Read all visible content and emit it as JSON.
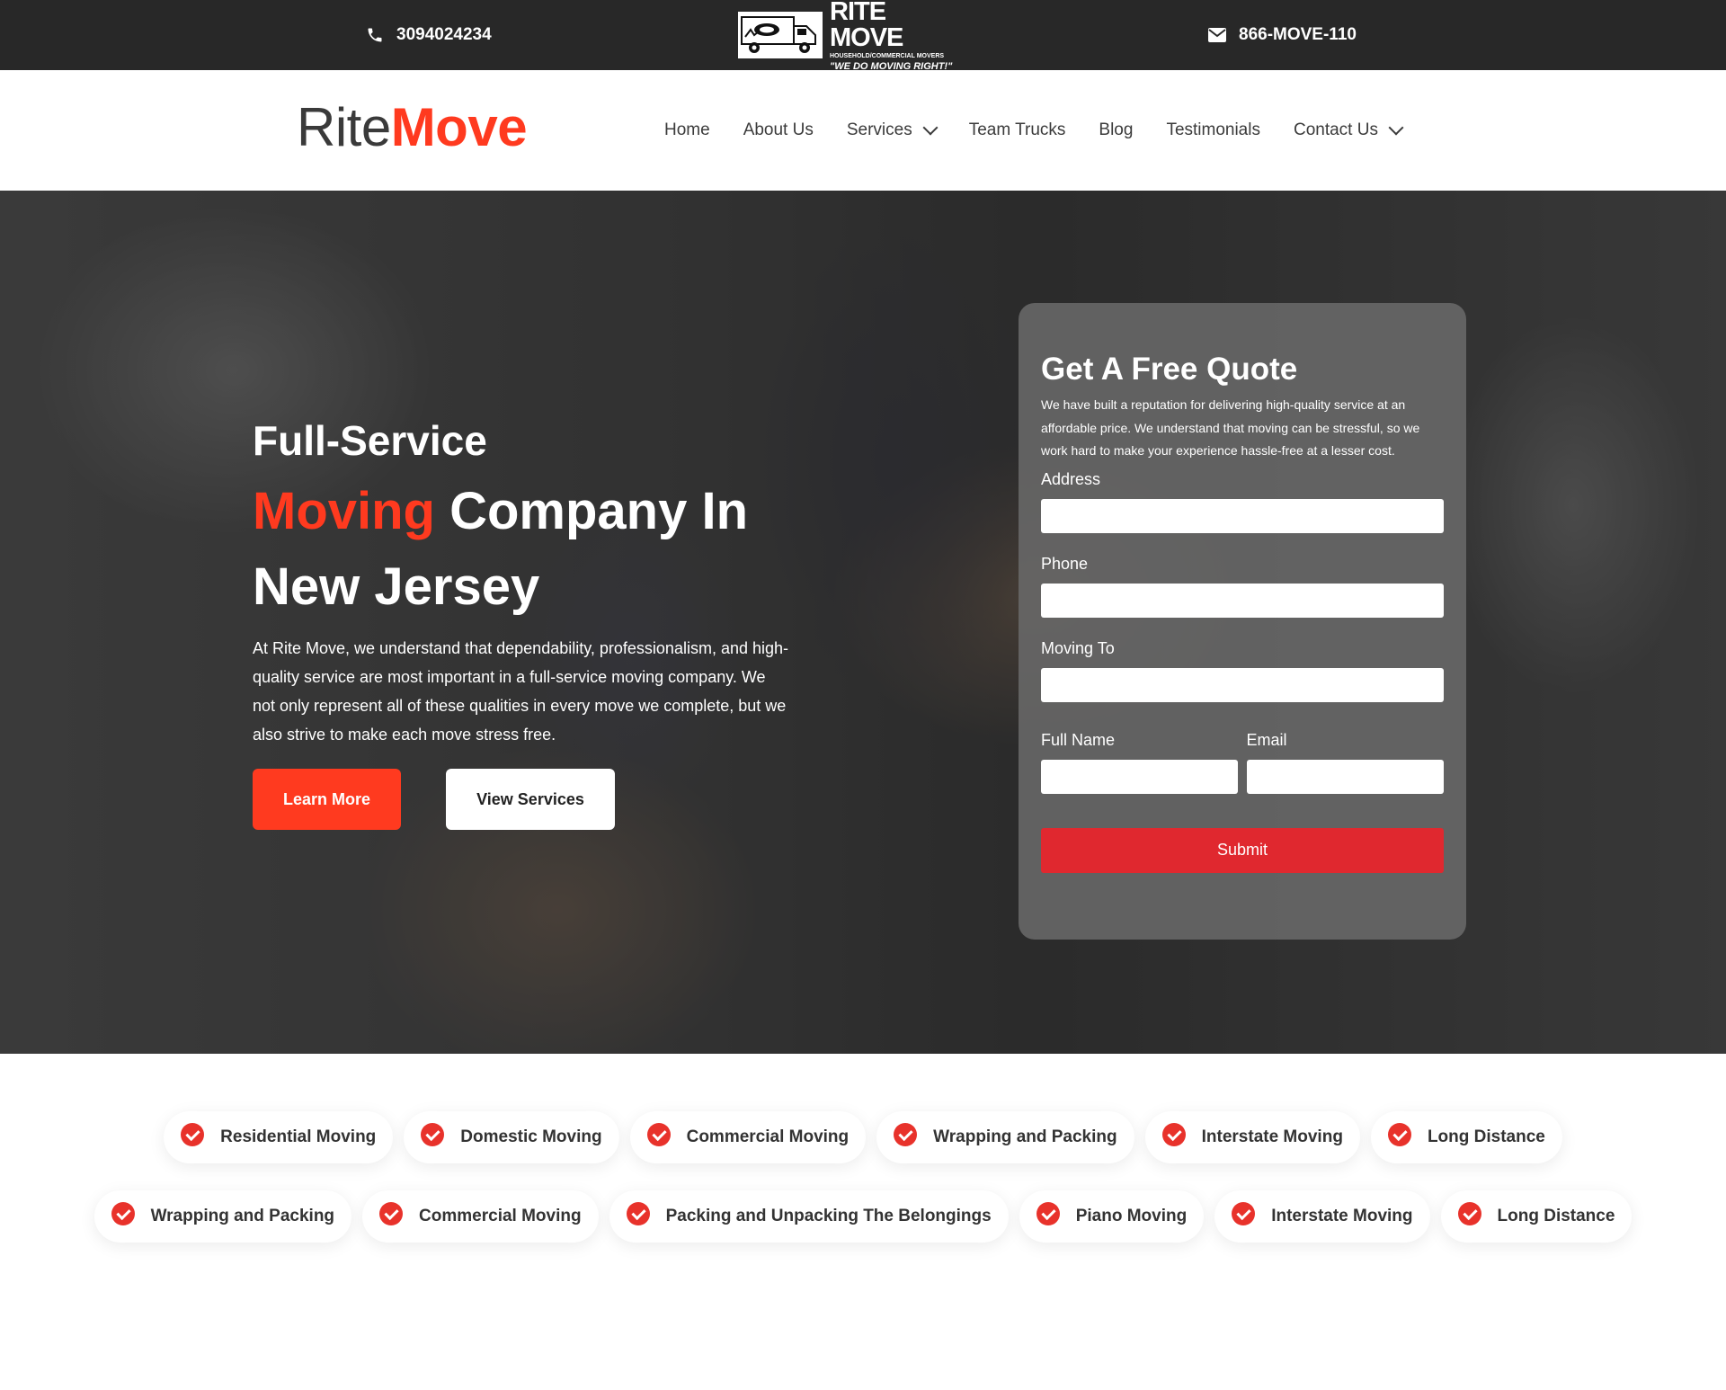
{
  "topbar": {
    "phone": "3094024234",
    "email_phone": "866-MOVE-110",
    "logo": {
      "name": "RITE MOVE",
      "tagline": "HOUSEHOLD/COMMERCIAL MOVERS",
      "slogan": "\"WE DO MOVING RIGHT!\""
    }
  },
  "header": {
    "brand_part1": "Rite",
    "brand_part2": "Move",
    "nav": [
      {
        "label": "Home"
      },
      {
        "label": "About Us"
      },
      {
        "label": "Services"
      },
      {
        "label": "Team Trucks"
      },
      {
        "label": "Blog"
      },
      {
        "label": "Testimonials"
      },
      {
        "label": "Contact Us"
      }
    ]
  },
  "hero": {
    "subtitle": "Full-Service",
    "title_accent": "Moving",
    "title_rest": " Company In New Jersey",
    "description": "At Rite Move, we understand that dependability, professionalism, and high-quality service are most important in a full-service moving company. We not only represent all of these qualities in every move we complete, but we also strive to make each move stress free.",
    "learn_more": "Learn More",
    "view_services": "View Services"
  },
  "quote_form": {
    "title": "Get A Free Quote",
    "description": "We have built a reputation for delivering high-quality service at an affordable price. We understand that moving can be stressful, so we work hard to make your experience hassle-free at a lesser cost.",
    "address_label": "Address",
    "phone_label": "Phone",
    "moving_to_label": "Moving To",
    "full_name_label": "Full Name",
    "email_label": "Email",
    "submit": "Submit"
  },
  "services_row1": [
    "Residential Moving",
    "Domestic Moving",
    "Commercial Moving",
    "Wrapping and Packing",
    "Interstate Moving",
    "Long Distance"
  ],
  "services_row2": [
    "Wrapping and Packing",
    "Commercial Moving",
    "Packing and Unpacking The Belongings",
    "Piano Moving",
    "Interstate Moving",
    "Long Distance"
  ],
  "colors": {
    "accent": "#ff3a1f",
    "submit": "#e0282f",
    "topbar": "#282828"
  }
}
